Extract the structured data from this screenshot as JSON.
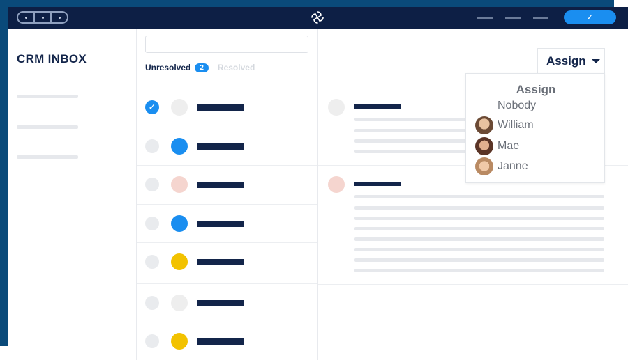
{
  "sidebar": {
    "title": "CRM INBOX"
  },
  "list": {
    "search_placeholder": "",
    "tabs": {
      "unresolved": "Unresolved",
      "unresolved_count": "2",
      "resolved": "Resolved"
    },
    "rows": [
      {
        "selected": true,
        "avatar_bg": "#eeeeee"
      },
      {
        "selected": false,
        "avatar_bg": "#1a8ef0"
      },
      {
        "selected": false,
        "avatar_bg": "#f5d5cf"
      },
      {
        "selected": false,
        "avatar_bg": "#1a8ef0"
      },
      {
        "selected": false,
        "avatar_bg": "#f2c200"
      },
      {
        "selected": false,
        "avatar_bg": "#eeeeee"
      },
      {
        "selected": false,
        "avatar_bg": "#f2c200"
      }
    ]
  },
  "assign": {
    "button_label": "Assign",
    "dropdown_title": "Assign",
    "options": [
      {
        "label": "Nobody"
      },
      {
        "label": "William"
      },
      {
        "label": "Mae"
      },
      {
        "label": "Janne"
      }
    ]
  },
  "toolbar": {
    "confirm_icon": "checkmark-icon"
  },
  "colors": {
    "navy": "#13254a",
    "accent": "#1a8ef0",
    "titlebar": "#0d1f45"
  }
}
